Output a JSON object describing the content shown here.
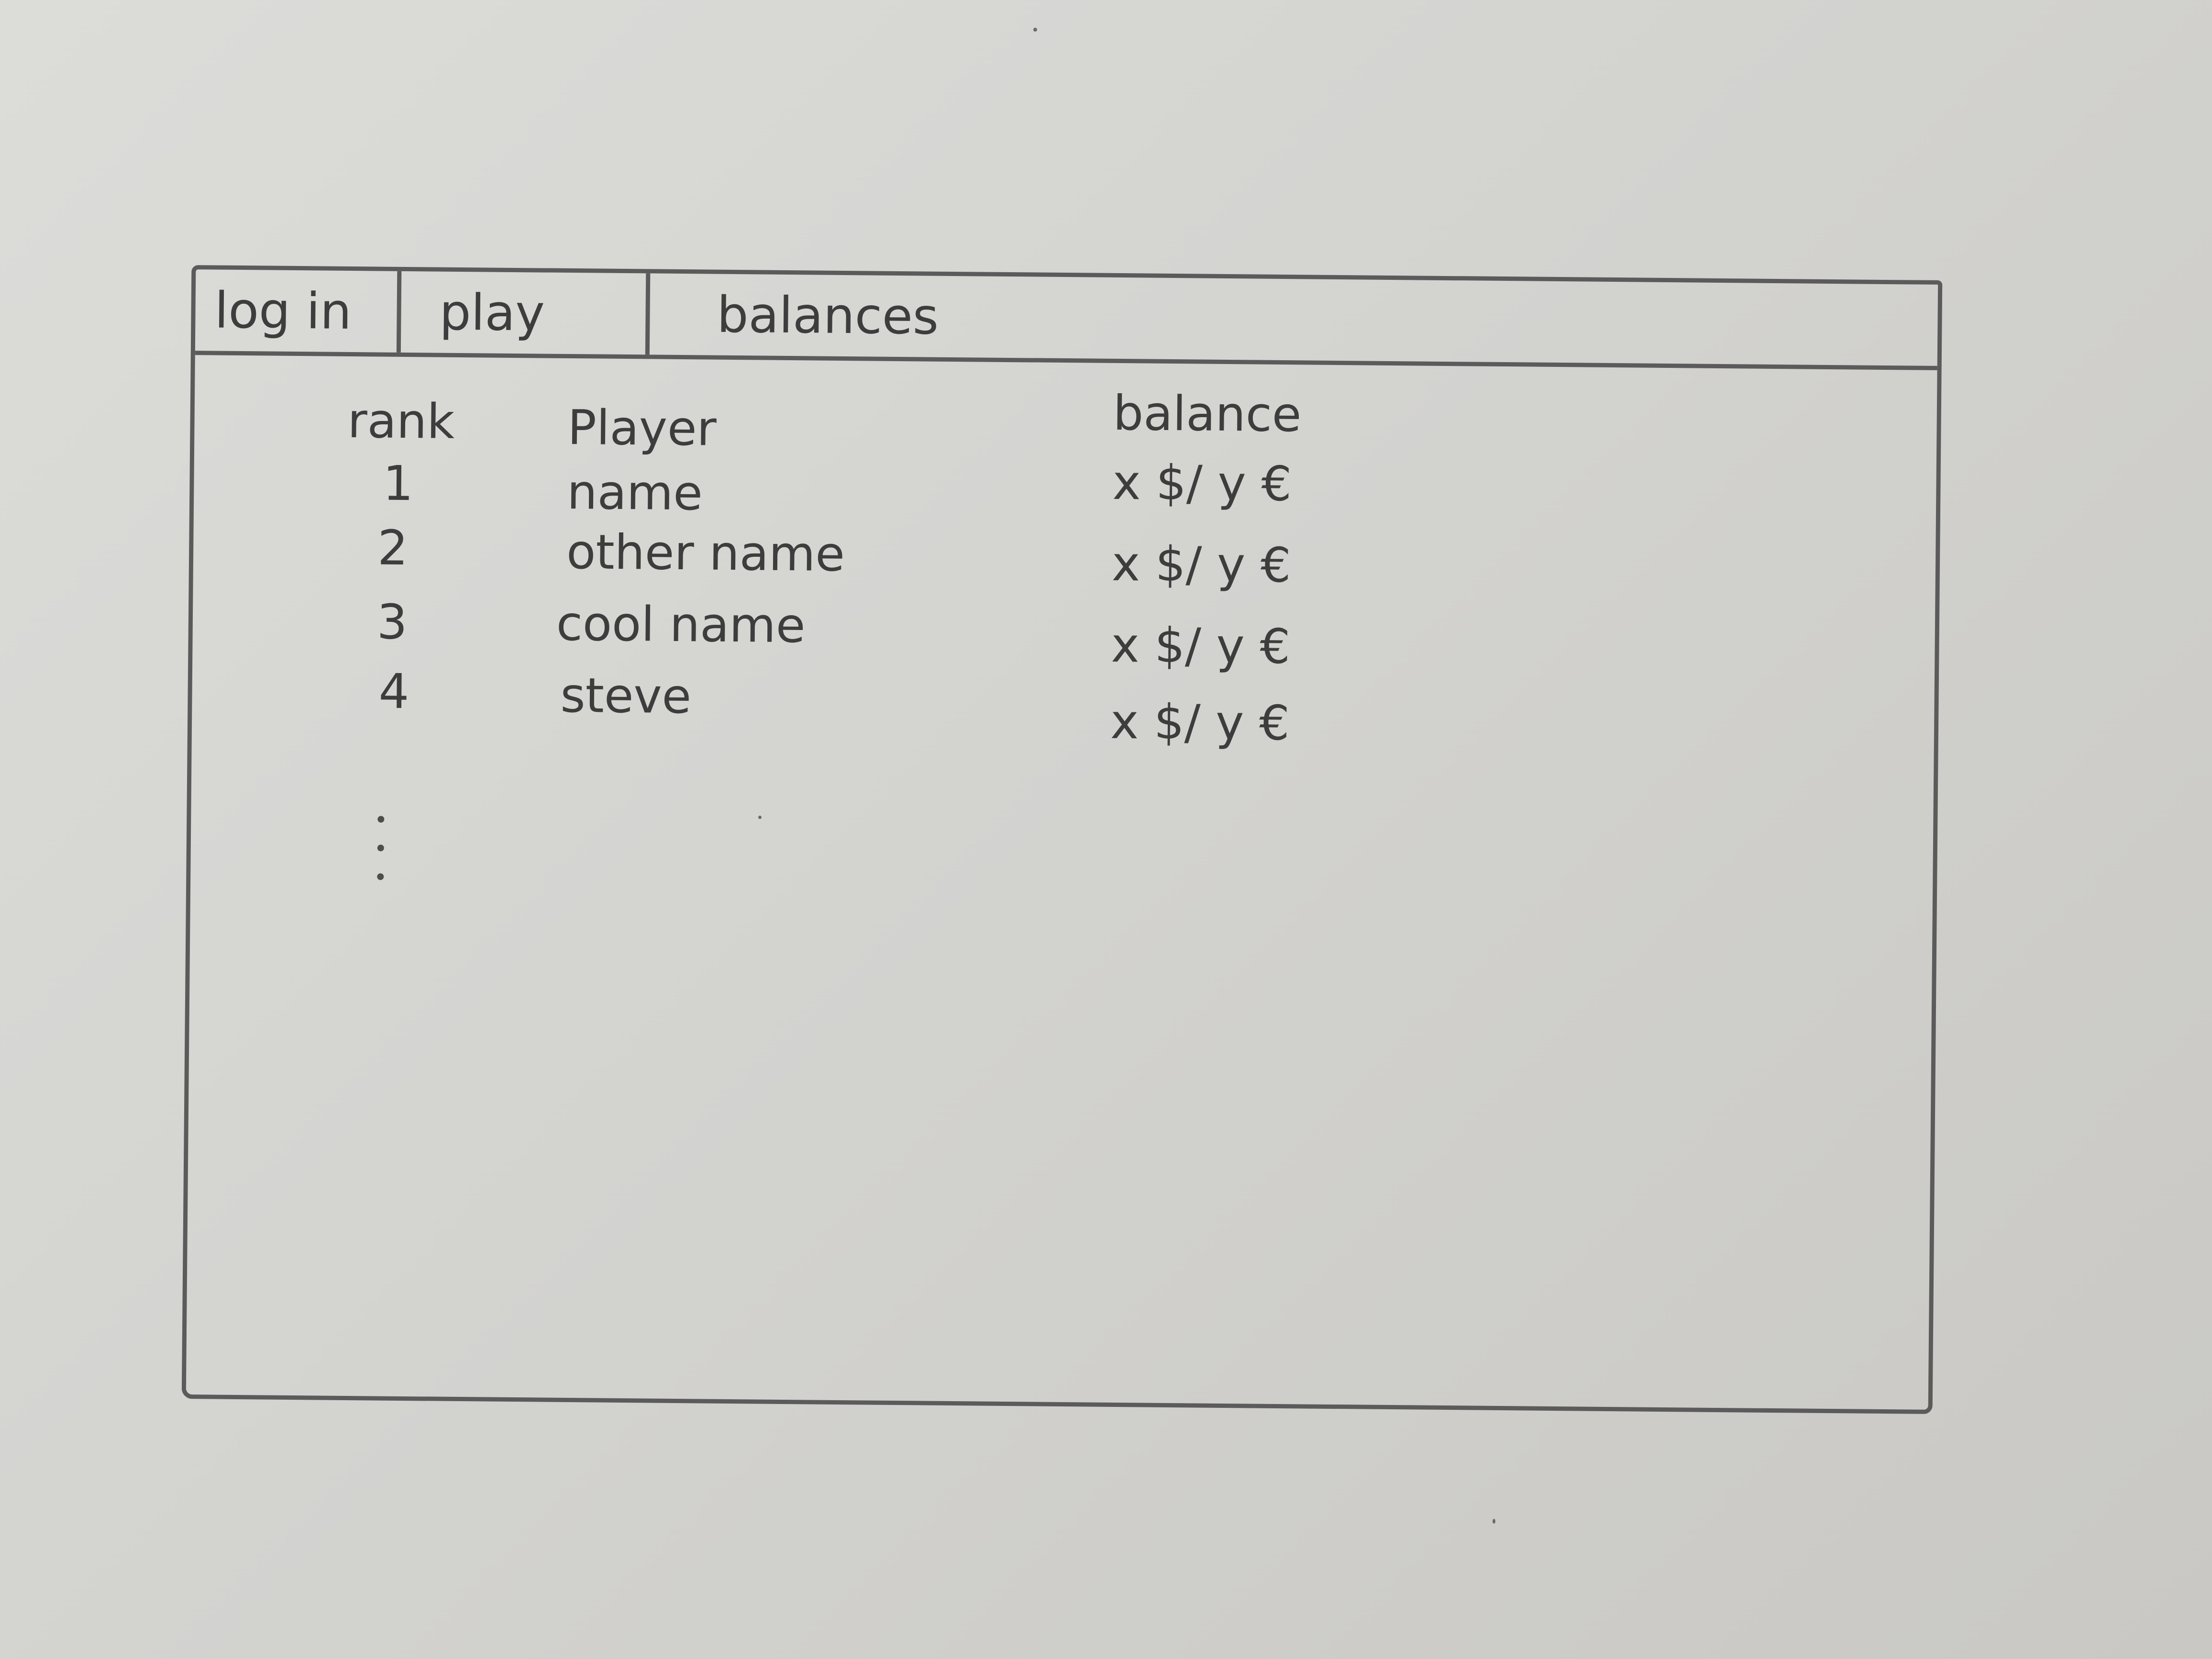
{
  "nav": {
    "tabs": [
      {
        "label": "log in"
      },
      {
        "label": "play"
      },
      {
        "label": "balances"
      }
    ]
  },
  "leaderboard": {
    "headers": {
      "rank": "rank",
      "player": "Player",
      "balance": "balance"
    },
    "rows": [
      {
        "rank": "1",
        "player": "name",
        "balance": "x $/ y €"
      },
      {
        "rank": "2",
        "player": "other name",
        "balance": "x $/ y €"
      },
      {
        "rank": "3",
        "player": "cool name",
        "balance": "x $/ y €"
      },
      {
        "rank": "4",
        "player": "steve",
        "balance": "x $/ y €"
      }
    ]
  }
}
